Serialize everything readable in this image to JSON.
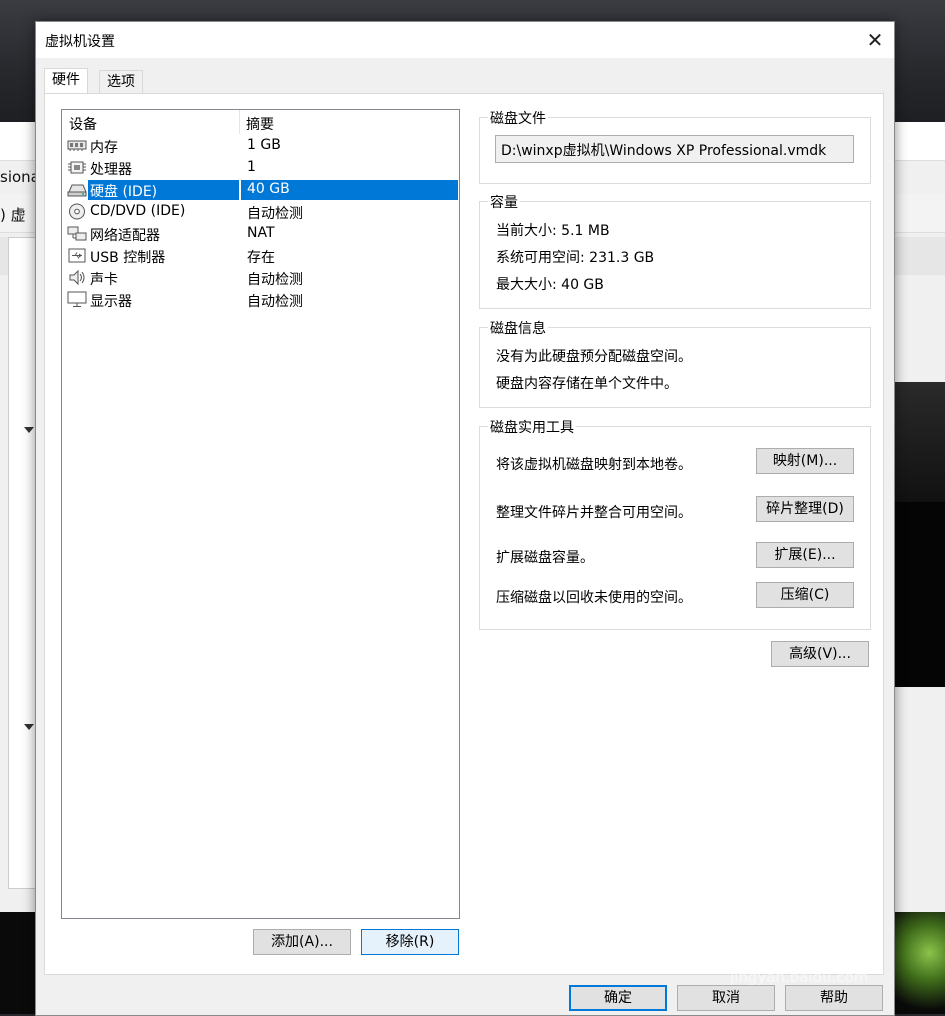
{
  "dialog": {
    "title": "虚拟机设置",
    "close_glyph": "✕"
  },
  "tabs": [
    "硬件",
    "选项"
  ],
  "device_list": {
    "col_device": "设备",
    "col_summary": "摘要",
    "rows": [
      {
        "name": "内存",
        "summary": "1 GB",
        "icon": "memory-icon"
      },
      {
        "name": "处理器",
        "summary": "1",
        "icon": "processor-icon"
      },
      {
        "name": "硬盘 (IDE)",
        "summary": "40 GB",
        "icon": "hard-disk-icon",
        "selected": true
      },
      {
        "name": "CD/DVD (IDE)",
        "summary": "自动检测",
        "icon": "cd-dvd-icon"
      },
      {
        "name": "网络适配器",
        "summary": "NAT",
        "icon": "network-adapter-icon"
      },
      {
        "name": "USB 控制器",
        "summary": "存在",
        "icon": "usb-icon"
      },
      {
        "name": "声卡",
        "summary": "自动检测",
        "icon": "sound-card-icon"
      },
      {
        "name": "显示器",
        "summary": "自动检测",
        "icon": "display-icon"
      }
    ]
  },
  "list_buttons": {
    "add": "添加(A)...",
    "remove": "移除(R)"
  },
  "disk_file": {
    "title": "磁盘文件",
    "path": "D:\\winxp虚拟机\\Windows XP Professional.vmdk"
  },
  "capacity": {
    "title": "容量",
    "current": "当前大小: 5.1 MB",
    "available": "系统可用空间: 231.3 GB",
    "max": "最大大小: 40 GB"
  },
  "disk_info": {
    "title": "磁盘信息",
    "line1": "没有为此硬盘预分配磁盘空间。",
    "line2": "硬盘内容存储在单个文件中。"
  },
  "utilities": {
    "title": "磁盘实用工具",
    "map_text": "将该虚拟机磁盘映射到本地卷。",
    "map_button": "映射(M)...",
    "defrag_text": "整理文件碎片并整合可用空间。",
    "defrag_button": "碎片整理(D)",
    "expand_text": "扩展磁盘容量。",
    "expand_button": "扩展(E)...",
    "compact_text": "压缩磁盘以回收未使用的空间。",
    "compact_button": "压缩(C)"
  },
  "advanced_button": "高级(V)...",
  "footer": {
    "ok": "确定",
    "cancel": "取消",
    "help": "帮助"
  },
  "background": {
    "frag1": "siona",
    "frag2": ") 虚"
  },
  "watermark": {
    "logo": "Bai 经验",
    "url": "jingyan.baidu.com"
  }
}
